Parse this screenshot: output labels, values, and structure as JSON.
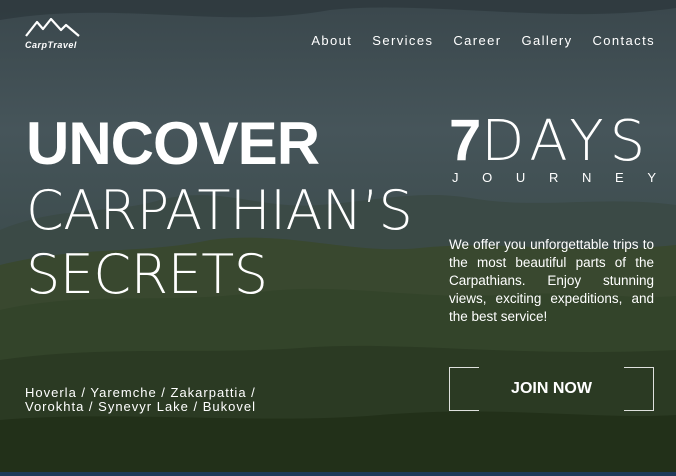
{
  "brand": {
    "logo_text": "CarpTravel"
  },
  "nav": {
    "items": [
      "About",
      "Services",
      "Career",
      "Gallery",
      "Contacts"
    ]
  },
  "hero": {
    "line1": "UNCOVER",
    "line2": "CARPATHIAN’S",
    "line3": "SECRETS",
    "places": "Hoverla / Yaremche / Zakarpattia / Vorokhta / Synevyr Lake / Bukovel"
  },
  "journey": {
    "number": "7",
    "days": "DAYS",
    "letters": [
      "J",
      "O",
      "U",
      "R",
      "N",
      "E",
      "Y"
    ]
  },
  "description": "We offer you unforgettable trips to the most beautiful parts of the Carpathians. Enjoy stunning views, exciting expeditions, and the best service!",
  "cta": {
    "label": "JOIN NOW"
  },
  "colors": {
    "bottom_bar": "#1d3a5a",
    "overlay": "#2d3a40"
  }
}
